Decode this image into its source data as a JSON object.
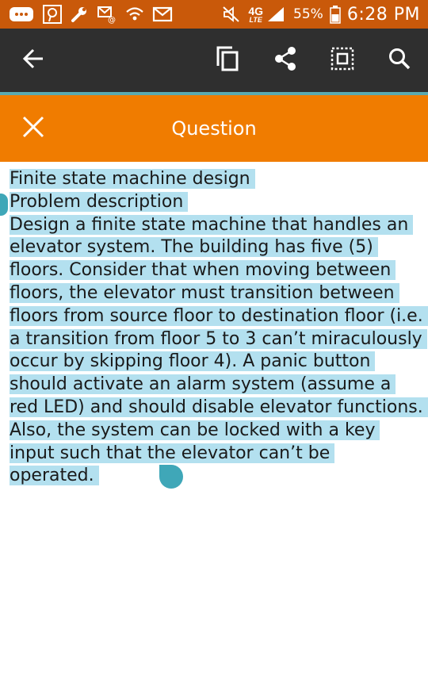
{
  "status_bar": {
    "battery": "55%",
    "time": "6:28 PM",
    "network": "4G",
    "network_sub": "LTE",
    "icons": [
      "messages-icon",
      "pinterest-icon",
      "wrench-icon",
      "email-notification-icon",
      "wifi-icon",
      "gmail-icon",
      "mute-icon",
      "signal-icon",
      "battery-icon"
    ]
  },
  "toolbar": {
    "icons": [
      "back-arrow-icon",
      "copy-icon",
      "share-icon",
      "select-all-icon",
      "search-icon"
    ]
  },
  "header": {
    "title": "Question"
  },
  "question": {
    "title": "Finite state machine design",
    "subtitle": "Problem description",
    "body": "Design a finite state machine that handles an elevator system. The building has five (5) floors. Consider that when moving between floors, the elevator must transition between floors from source floor to destination floor (i.e. a transition from floor 5 to 3 can’t miraculously occur by skipping floor 4). A panic button should activate an alarm system (assume a red LED) and should disable elevator functions. Also, the system can be locked with a key input such that the elevator can’t be operated."
  },
  "colors": {
    "status_bar": "#c9590a",
    "toolbar": "#2f2f2f",
    "accent_line": "#5aaab0",
    "header": "#f07c00",
    "selection": "#b3e0ef",
    "handle": "#3fa7b8"
  }
}
